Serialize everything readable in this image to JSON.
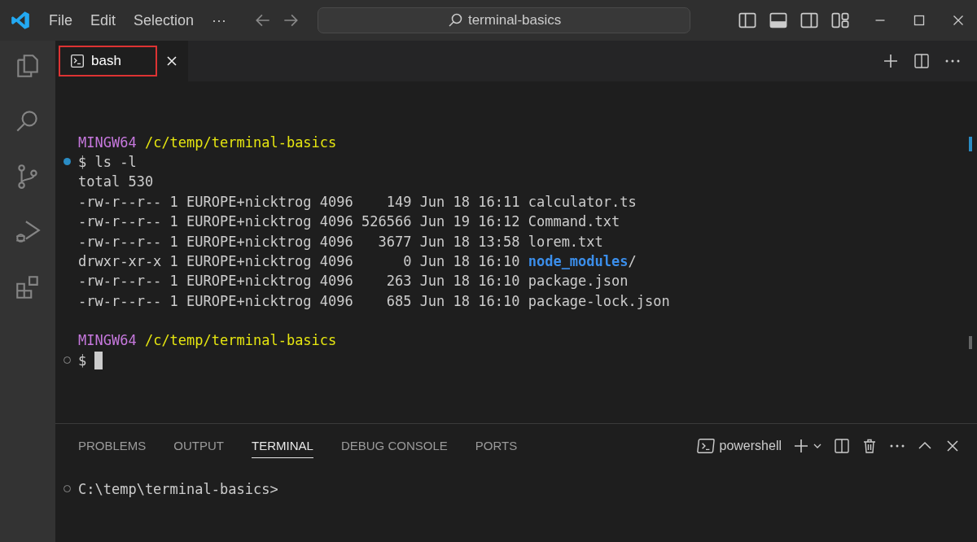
{
  "title_bar": {
    "menu": [
      "File",
      "Edit",
      "Selection",
      "···"
    ],
    "search": {
      "value": "terminal-basics"
    }
  },
  "editor_tabs": [
    {
      "label": "bash",
      "selected": true,
      "highlighted": true
    }
  ],
  "terminal": {
    "lines": [
      {
        "kind": "blank"
      },
      {
        "kind": "prompt",
        "user": "MINGW64",
        "path": "/c/temp/terminal-basics"
      },
      {
        "kind": "command",
        "succeeded": true,
        "text": "$ ls -l"
      },
      {
        "kind": "output",
        "text": "total 530"
      },
      {
        "kind": "file",
        "info": "-rw-r--r-- 1 EUROPE+nicktrog 4096    149 Jun 18 16:11 ",
        "name": "calculator.ts",
        "dir": false
      },
      {
        "kind": "file",
        "info": "-rw-r--r-- 1 EUROPE+nicktrog 4096 526566 Jun 19 16:12 ",
        "name": "Command.txt",
        "dir": false
      },
      {
        "kind": "file",
        "info": "-rw-r--r-- 1 EUROPE+nicktrog 4096   3677 Jun 18 13:58 ",
        "name": "lorem.txt",
        "dir": false
      },
      {
        "kind": "file",
        "info": "drwxr-xr-x 1 EUROPE+nicktrog 4096      0 Jun 18 16:10 ",
        "name": "node_modules",
        "dir": true,
        "suffix": "/"
      },
      {
        "kind": "file",
        "info": "-rw-r--r-- 1 EUROPE+nicktrog 4096    263 Jun 18 16:10 ",
        "name": "package.json",
        "dir": false
      },
      {
        "kind": "file",
        "info": "-rw-r--r-- 1 EUROPE+nicktrog 4096    685 Jun 18 16:10 ",
        "name": "package-lock.json",
        "dir": false
      },
      {
        "kind": "blank"
      },
      {
        "kind": "prompt",
        "user": "MINGW64",
        "path": "/c/temp/terminal-basics"
      },
      {
        "kind": "command",
        "succeeded": false,
        "text": "$",
        "cursor": true
      }
    ]
  },
  "panel": {
    "tabs": [
      {
        "label": "PROBLEMS",
        "selected": false
      },
      {
        "label": "OUTPUT",
        "selected": false
      },
      {
        "label": "TERMINAL",
        "selected": true
      },
      {
        "label": "DEBUG CONSOLE",
        "selected": false
      },
      {
        "label": "PORTS",
        "selected": false
      }
    ],
    "shell": "powershell",
    "lines": [
      {
        "succeeded": false,
        "text": "C:\\temp\\terminal-basics>"
      }
    ]
  }
}
